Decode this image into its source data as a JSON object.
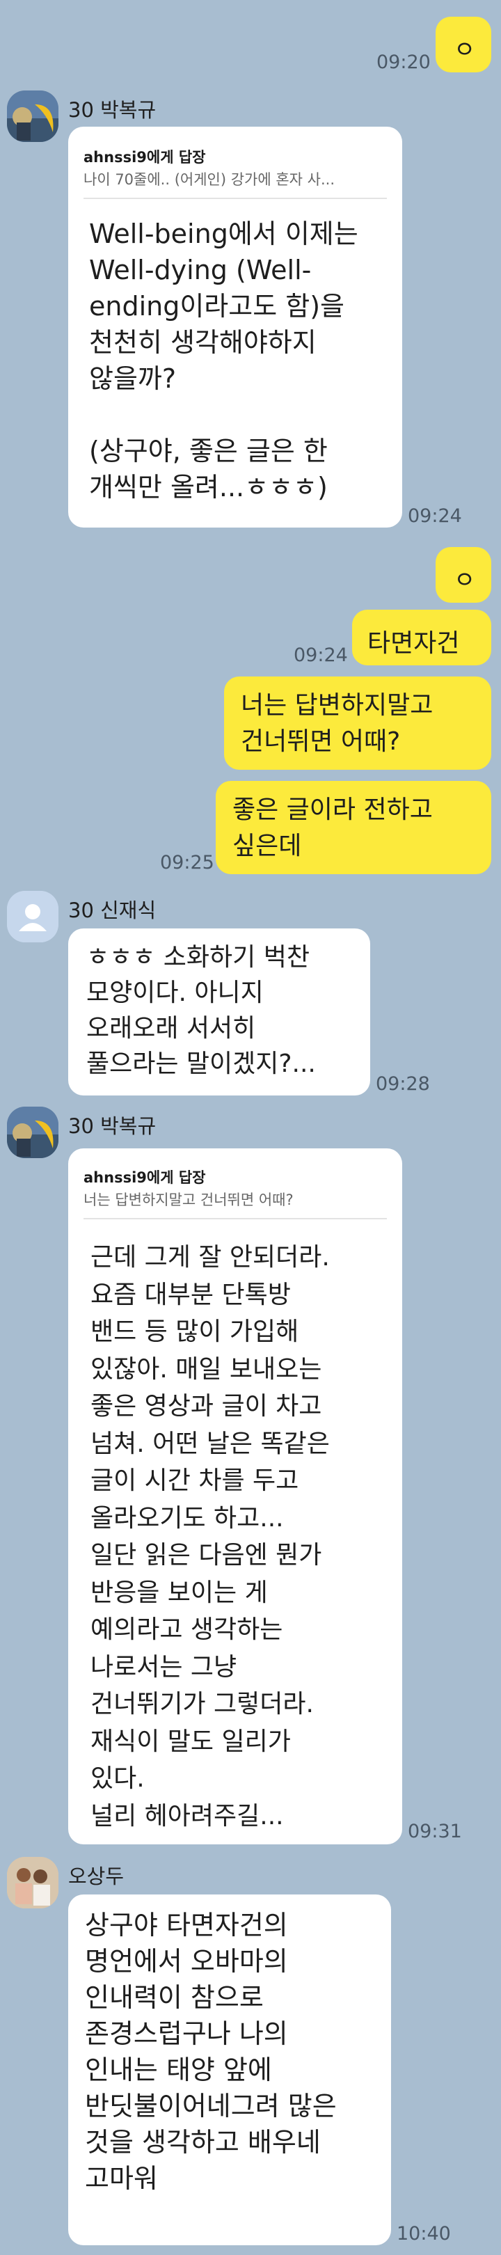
{
  "messages": {
    "m1": {
      "text": "ㅇ",
      "time": "09:20"
    },
    "m2": {
      "sender": "30 박복규",
      "reply_to": "ahnssi9에게 답장",
      "reply_preview": "나이 70줄에..  (어게인) 강가에 혼자 사...",
      "text": "Well-being에서 이제는\nWell-dying  (Well-\nending이라고도 함)을\n천천히 생각해야하지\n않을까?\n\n(상구야, 좋은 글은 한\n개씩만 올려...ㅎㅎㅎ)",
      "time": "09:24"
    },
    "m3": {
      "text": "ㅇ"
    },
    "m4": {
      "text": "타면자건",
      "time": "09:24"
    },
    "m5": {
      "text": "너는 답변하지말고\n건너뛰면 어때?"
    },
    "m6": {
      "text": "좋은 글이라 전하고\n싶은데",
      "time": "09:25"
    },
    "m7": {
      "sender": "30 신재식",
      "text": "ㅎㅎㅎ 소화하기 벅찬\n모양이다. 아니지\n오래오래 서서히\n풀으라는 말이겠지?...",
      "time": "09:28"
    },
    "m8": {
      "sender": "30 박복규",
      "reply_to": "ahnssi9에게 답장",
      "reply_preview": "너는 답변하지말고 건너뛰면 어때?",
      "text": "근데 그게 잘 안되더라.\n요즘 대부분 단톡방\n밴드 등 많이 가입해\n있잖아. 매일 보내오는\n좋은 영상과 글이 차고\n넘쳐. 어떤 날은 똑같은\n글이 시간 차를 두고\n올라오기도 하고...\n일단 읽은 다음엔 뭔가\n반응을 보이는 게\n예의라고 생각하는\n나로서는 그냥\n건너뛰기가 그렇더라.\n재식이 말도 일리가\n있다.\n널리 헤아려주길...",
      "time": "09:31"
    },
    "m9": {
      "sender": "오상두",
      "text": "상구야 타면자건의\n명언에서 오바마의\n인내력이 참으로\n존경스럽구나 나의\n인내는   태양 앞에\n반딧불이어네그려 많은\n것을 생각하고 배우네\n고마워",
      "time": "10:40"
    }
  },
  "colors": {
    "background": "#a8bdd0",
    "outgoing_bubble": "#fcea3c",
    "incoming_bubble": "#ffffff"
  }
}
